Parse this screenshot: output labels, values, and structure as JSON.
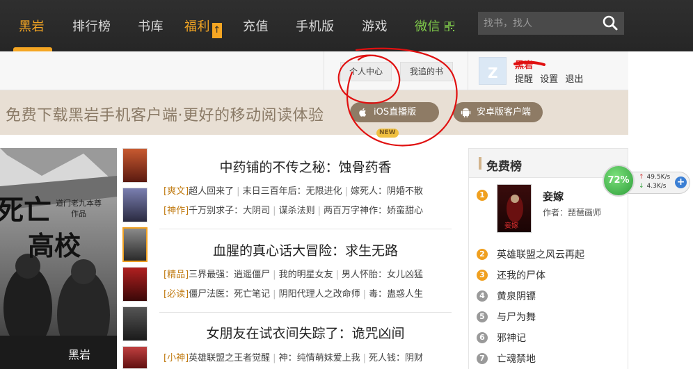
{
  "nav": {
    "items": [
      {
        "label": "黑岩",
        "active": true
      },
      {
        "label": "排行榜"
      },
      {
        "label": "书库"
      },
      {
        "label": "福利"
      },
      {
        "label": "充值"
      },
      {
        "label": "手机版"
      },
      {
        "label": "游戏"
      },
      {
        "label": "微信"
      }
    ],
    "welfare_badge": "↑",
    "search_placeholder": "找书，找人"
  },
  "userbar": {
    "personal_center": "个人中心",
    "my_follow": "我追的书",
    "username": "黑岩",
    "links": [
      "提醒",
      "设置",
      "退出"
    ]
  },
  "banner": {
    "text": "免费下载黑岩手机客户端·更好的移动阅读体验",
    "ios_label": "iOS直播版",
    "ios_badge": "NEW",
    "android_label": "安卓版客户端"
  },
  "feature": {
    "cover_title_1": "死亡",
    "cover_title_2": "高校",
    "cover_author": "道门老九本尊 作品",
    "cover_logo": "黑岩"
  },
  "stories": [
    {
      "title": "中药铺的不传之秘：蚀骨药香",
      "lines": [
        {
          "tag": "[爽文]",
          "items": [
            "超人回来了",
            "末日三百年后：无限进化",
            "嫁死人：阴婚不散"
          ]
        },
        {
          "tag": "[神作]",
          "items": [
            "千万别求子：大阴司",
            "谋杀法则",
            "两百万字神作：娇蛮甜心"
          ]
        }
      ]
    },
    {
      "title": "血腥的真心话大冒险：求生无路",
      "lines": [
        {
          "tag": "[精品]",
          "items": [
            "三界最强：逍遥僵尸",
            "我的明星女友",
            "男人怀胎：女儿凶猛"
          ]
        },
        {
          "tag": "[必读]",
          "items": [
            "僵尸法医：死亡笔记",
            "阴阳代理人之改命师",
            "毒：蛊惑人生"
          ]
        }
      ]
    },
    {
      "title": "女朋友在试衣间失踪了：诡咒凶间",
      "lines": [
        {
          "tag": "[小神]",
          "items": [
            "英雄联盟之王者觉醒",
            "神：纯情萌妹爱上我",
            "死人钱：阴财"
          ]
        }
      ]
    }
  ],
  "ranking": {
    "title": "免费榜",
    "first": {
      "num": "1",
      "title": "妾嫁",
      "author": "作者：琵琶画师"
    },
    "items": [
      {
        "num": "2",
        "name": "英雄联盟之风云再起"
      },
      {
        "num": "3",
        "name": "还我的尸体"
      },
      {
        "num": "4",
        "name": "黄泉阴镖"
      },
      {
        "num": "5",
        "name": "与尸为舞"
      },
      {
        "num": "6",
        "name": "邪神记"
      },
      {
        "num": "7",
        "name": "亡魂禁地"
      }
    ]
  },
  "speed_widget": {
    "percent": "72%",
    "upload": "49.5K/s",
    "download": "4.3K/s",
    "plus": "+"
  },
  "colors": {
    "accent": "#f5a623",
    "nav_bg": "#2b2b2b",
    "banner_bg": "#e8dfd4",
    "tag": "#c07a10",
    "annotation": "#e01010"
  }
}
